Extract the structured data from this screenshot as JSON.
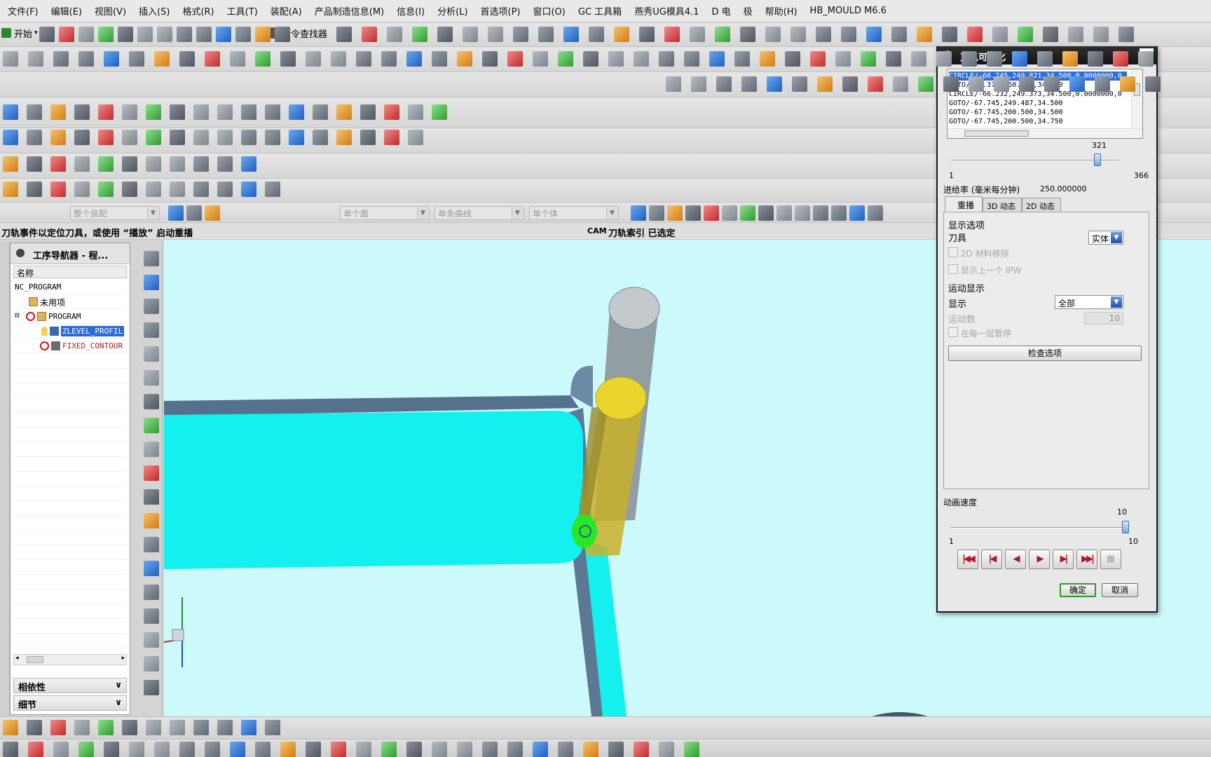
{
  "menubar": {
    "items": [
      "文件(F)",
      "编辑(E)",
      "视图(V)",
      "插入(S)",
      "格式(R)",
      "工具(T)",
      "装配(A)",
      "产品制造信息(M)",
      "信息(I)",
      "分析(L)",
      "首选项(P)",
      "窗口(O)",
      "GC 工具箱",
      "燕秀UG模具4.1",
      "D 电",
      "极",
      "帮助(H)",
      "HB_MOULD M6.6"
    ]
  },
  "toolbar": {
    "start_label": "开始",
    "command_finder_label": "命令查找器"
  },
  "selection_bar": {
    "assembly_filter": "整个装配",
    "face_rule": "单个面",
    "curve_rule": "单条曲线",
    "body_rule": "单个体"
  },
  "status": {
    "prompt": "刀轨事件以定位刀具，或使用 “播放” 启动重播",
    "cam_tag": "CAM",
    "right_text": "刀轨索引  已选定"
  },
  "navigator": {
    "title": "工序导航器 - 程...",
    "column_header": "名称",
    "rows": [
      "NC_PROGRAM",
      "未用项",
      "PROGRAM",
      "ZLEVEL_PROFIL",
      "FIXED_CONTOUR"
    ],
    "selected_row": "ZLEVEL_PROFIL",
    "section_dependencies": "相依性",
    "section_details": "细节"
  },
  "dialog": {
    "title": "刀轨可视化",
    "close_icon": "close-icon",
    "gcode_lines": [
      "CIRCLE/-66.745,249.821,34.500,0.0000000,0",
      "GOTO/-67.377,250.369,34.500",
      "CIRCLE/-66.232,249.373,34.500,0.0000000,0",
      "GOTO/-67.745,249.487,34.500",
      "GOTO/-67.745,200.500,34.500",
      "GOTO/-67.745,200.500,34.750"
    ],
    "selected_gcode_index": 0,
    "path_slider": {
      "min": "1",
      "max": "366",
      "value": "321",
      "fraction": 0.877
    },
    "feed_label": "进给率 (毫米每分钟)",
    "feed_value": "250.000000",
    "tabs": [
      "重播",
      "3D 动态",
      "2D 动态"
    ],
    "active_tab": "重播",
    "display_options_header": "显示选项",
    "tool_label": "刀具",
    "tool_value": "实体",
    "chk_2d_material": "2D 材料移除",
    "chk_prev_ipw": "显示上一个 IPW",
    "motion_display_header": "运动显示",
    "display_label": "显示",
    "display_value": "全部",
    "motion_count_label": "运动数",
    "motion_count_value": "10",
    "chk_pause_each_layer": "在每一层暂停",
    "check_options_button": "检查选项",
    "speed_label": "动画速度",
    "speed_slider": {
      "min": "1",
      "max": "10",
      "value": "10",
      "fraction": 1.0
    },
    "playback_icons": [
      "rewind-to-start-icon",
      "step-back-icon",
      "play-reverse-icon",
      "play-icon",
      "step-forward-icon",
      "fast-forward-to-end-icon",
      "stop-icon"
    ],
    "ok_button": "确定",
    "cancel_button": "取消"
  },
  "colors": {
    "viewport_bg": "#ccfafa",
    "part_top": "#14f0f0",
    "part_wall": "#4f6b86",
    "tool_shank": "#8e969c",
    "tool_holder_tip": "#e9d33a",
    "highlight": "#29e629",
    "dialog_title_bg": "#1e1e1e",
    "selection": "#2f6fdb"
  }
}
